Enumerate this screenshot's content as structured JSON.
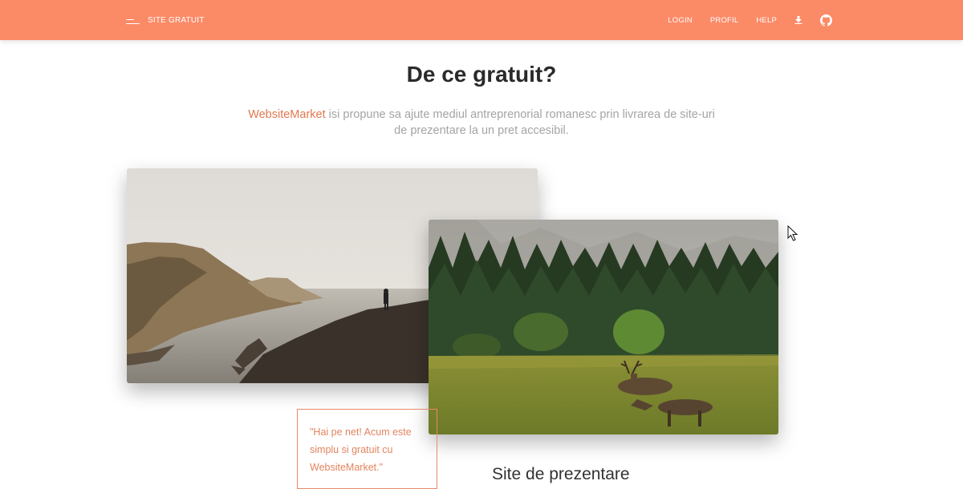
{
  "navbar": {
    "brand_label": "SITE GRATUIT",
    "links": [
      "LOGIN",
      "PROFIL",
      "HELP"
    ],
    "icons": [
      "download-icon",
      "github-icon"
    ],
    "background": "#fb8a67"
  },
  "hero": {
    "title": "De ce gratuit?",
    "brand_link": "WebsiteMarket",
    "intro_rest": " isi propune sa ajute mediul antreprenorial romanesc prin livrarea de site-uri de prezentare la un pret accesibil."
  },
  "quote": "\"Hai pe net! Acum este simplu si gratuit cu WebsiteMarket.\"",
  "subheading": "Site de prezentare",
  "colors": {
    "accent": "#e2784f",
    "title": "#2a2a2a",
    "muted": "#a4a4a4"
  }
}
